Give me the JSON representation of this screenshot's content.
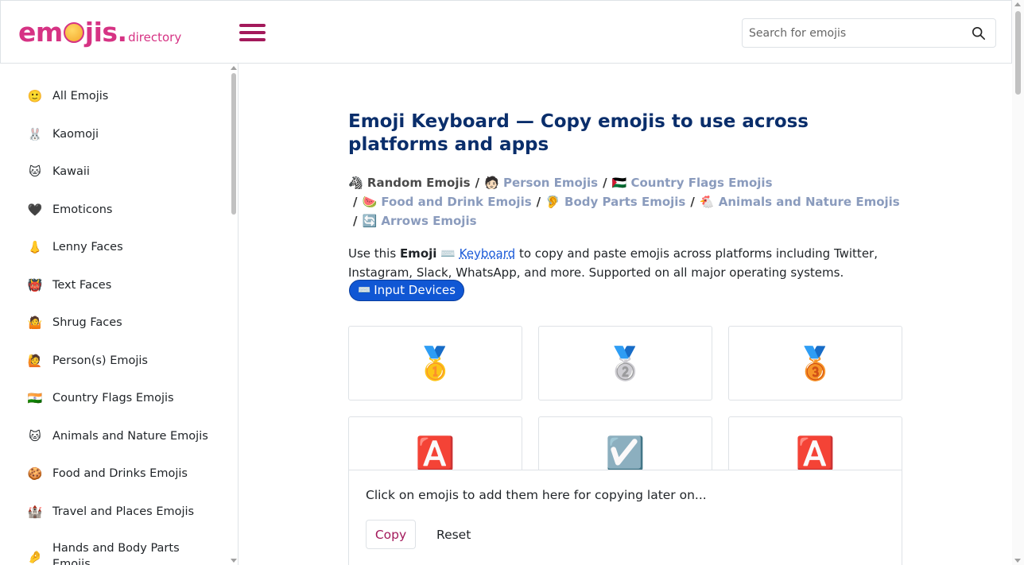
{
  "header": {
    "logo_main_left": "em",
    "logo_main_right": "jis",
    "logo_dot": ".",
    "logo_sub": "directory",
    "search_placeholder": "Search for emojis"
  },
  "sidebar": {
    "items": [
      {
        "icon": "🙂",
        "label": "All Emojis"
      },
      {
        "icon": "🐰",
        "label": "Kaomoji"
      },
      {
        "icon": "🐱",
        "label": "Kawaii"
      },
      {
        "icon": "🖤",
        "label": "Emoticons"
      },
      {
        "icon": "👃",
        "label": "Lenny Faces"
      },
      {
        "icon": "👹",
        "label": "Text Faces"
      },
      {
        "icon": "🤷",
        "label": "Shrug Faces"
      },
      {
        "icon": "🙋",
        "label": "Person(s) Emojis"
      },
      {
        "icon": "🇮🇳",
        "label": "Country Flags Emojis"
      },
      {
        "icon": "🐱",
        "label": "Animals and Nature Emojis"
      },
      {
        "icon": "🍪",
        "label": "Food and Drinks Emojis"
      },
      {
        "icon": "🏰",
        "label": "Travel and Places Emojis"
      },
      {
        "icon": "🤌",
        "label": "Hands and Body Parts Emojis"
      }
    ]
  },
  "main": {
    "title": "Emoji Keyboard — Copy emojis to use across platforms and apps",
    "breadcrumbs": [
      {
        "icon": "🦓",
        "label": "Random Emojis"
      },
      {
        "icon": "🧑🏻",
        "label": "Person Emojis"
      },
      {
        "icon": "🇵🇸",
        "label": "Country Flags Emojis"
      },
      {
        "icon": "🍉",
        "label": "Food and Drink Emojis"
      },
      {
        "icon": "🦻",
        "label": "Body Parts Emojis"
      },
      {
        "icon": "🐔",
        "label": "Animals and Nature Emojis"
      },
      {
        "icon": "🔄",
        "label": "Arrows Emojis"
      }
    ],
    "desc_prefix": "Use this ",
    "desc_bold": "Emoji",
    "desc_link_icon": "⌨️",
    "desc_link": "Keyboard",
    "desc_suffix": " to copy and paste emojis across platforms including Twitter, Instagram, Slack, WhatsApp, and more. Supported on all major operating systems.",
    "pill_icon": "⌨️",
    "pill_label": "Input Devices",
    "cards": [
      "🥇",
      "🥈",
      "🥉",
      "🅰️",
      "☑️",
      "🅰️"
    ]
  },
  "copy_panel": {
    "hint": "Click on emojis to add them here for copying later on...",
    "copy_label": "Copy",
    "reset_label": "Reset"
  },
  "colors": {
    "brand": "#d63384",
    "title": "#0a2e6b",
    "link": "#8a9bbd",
    "pill": "#1057d4"
  }
}
